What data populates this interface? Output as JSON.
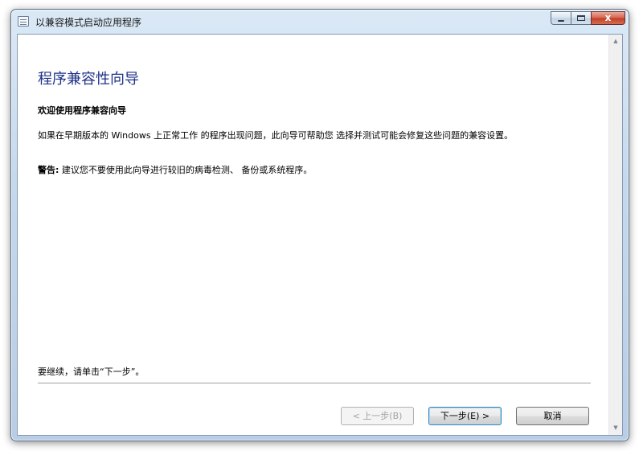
{
  "window": {
    "title": "以兼容模式启动应用程序",
    "close_glyph": "x"
  },
  "wizard": {
    "heading": "程序兼容性向导",
    "subheading": "欢迎使用程序兼容向导",
    "paragraph": "如果在早期版本的 Windows 上正常工作 的程序出现问题，此向导可帮助您 选择并测试可能会修复这些问题的兼容设置。",
    "warning_label": "警告:",
    "warning_text": " 建议您不要使用此向导进行较旧的病毒检测、 备份或系统程序。",
    "continue_hint": "要继续，请单击“下一步”。"
  },
  "buttons": {
    "back": "< 上一步(B)",
    "next": "下一步(E) >",
    "cancel": "取消"
  },
  "scrollbar": {
    "up_glyph": "▲",
    "down_glyph": "▼"
  },
  "colors": {
    "heading": "#1e3287",
    "frame": "#c4d8ee",
    "close_button": "#c13d26"
  },
  "icons": {
    "app": "window-list-icon",
    "minimize": "minimize-icon",
    "maximize": "maximize-icon",
    "close": "close-icon"
  }
}
